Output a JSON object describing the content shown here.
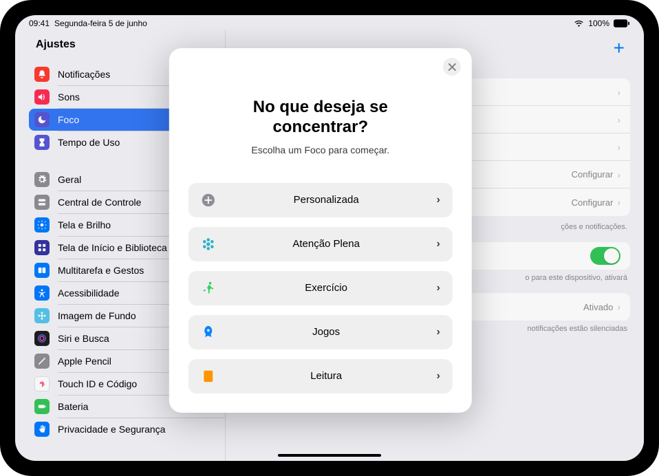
{
  "statusbar": {
    "time": "09:41",
    "date": "Segunda-feira 5 de junho",
    "battery_pct": "100%"
  },
  "sidebar": {
    "title": "Ajustes",
    "group1": [
      {
        "label": "Notificações",
        "color": "#ff3b30"
      },
      {
        "label": "Sons",
        "color": "#ff2d55"
      },
      {
        "label": "Foco",
        "color": "#5856d6",
        "selected": true
      },
      {
        "label": "Tempo de Uso",
        "color": "#5856d6"
      }
    ],
    "group2": [
      {
        "label": "Geral",
        "color": "#8e8e93"
      },
      {
        "label": "Central de Controle",
        "color": "#8e8e93"
      },
      {
        "label": "Tela e Brilho",
        "color": "#007aff"
      },
      {
        "label": "Tela de Início e Biblioteca",
        "color": "#3634a3"
      },
      {
        "label": "Multitarefa e Gestos",
        "color": "#007aff"
      },
      {
        "label": "Acessibilidade",
        "color": "#007aff"
      },
      {
        "label": "Imagem de Fundo",
        "color": "#54c7ec"
      },
      {
        "label": "Siri e Busca",
        "color": "#1e1e1e"
      },
      {
        "label": "Apple Pencil",
        "color": "#8e8e93"
      },
      {
        "label": "Touch ID e Código",
        "color": "#ff3465"
      },
      {
        "label": "Bateria",
        "color": "#34c759"
      },
      {
        "label": "Privacidade e Segurança",
        "color": "#007aff"
      }
    ]
  },
  "main": {
    "rows": {
      "configure1": "Configurar",
      "configure2": "Configurar",
      "caption1": "ções e notificações.",
      "caption2": "o para este dispositivo, ativará",
      "activated": "Ativado",
      "caption3": "notificações estão silenciadas"
    }
  },
  "modal": {
    "title": "No que deseja se concentrar?",
    "subtitle": "Escolha um Foco para começar.",
    "options": [
      {
        "label": "Personalizada",
        "icon": "plus",
        "color": "#8e8e93"
      },
      {
        "label": "Atenção Plena",
        "icon": "mindfulness",
        "color": "#30b0c7"
      },
      {
        "label": "Exercício",
        "icon": "running",
        "color": "#30d158"
      },
      {
        "label": "Jogos",
        "icon": "rocket",
        "color": "#0a84ff"
      },
      {
        "label": "Leitura",
        "icon": "book",
        "color": "#ff9500"
      }
    ]
  }
}
